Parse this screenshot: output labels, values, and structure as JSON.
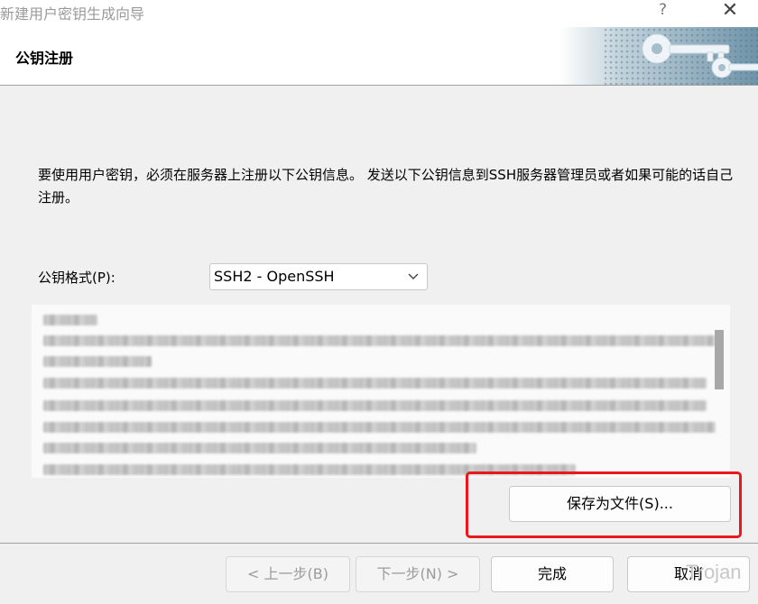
{
  "window": {
    "title": "新建用户密钥生成向导",
    "help_label": "?",
    "close_label": "✕"
  },
  "header": {
    "title": "公钥注册",
    "banner_icon": "key-icon"
  },
  "description": "要使用用户密钥，必须在服务器上注册以下公钥信息。 发送以下公钥信息到SSH服务器管理员或者如果可能的话自己注册。",
  "format": {
    "label": "公钥格式(P):",
    "selected": "SSH2 - OpenSSH"
  },
  "save_button": "保存为文件(S)...",
  "footer": {
    "back": "< 上一步(B)",
    "next": "下一步(N) >",
    "finish": "完成",
    "cancel": "取消"
  },
  "watermark": "Trojan",
  "colors": {
    "highlight": "#e8181d",
    "banner": "#7a9db0"
  }
}
